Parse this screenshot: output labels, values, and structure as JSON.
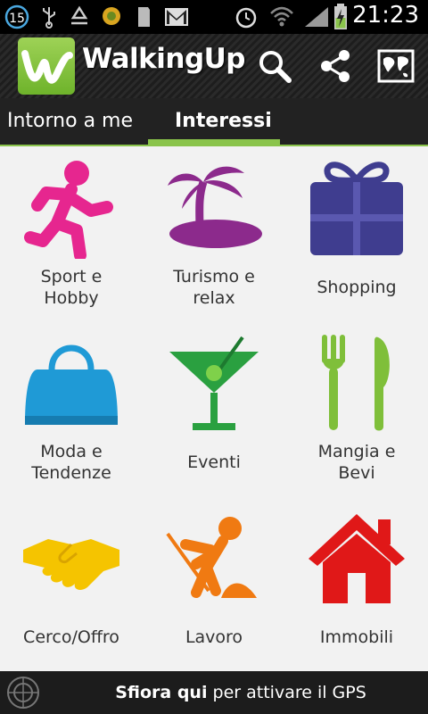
{
  "status_bar": {
    "notification_count": "15",
    "time": "21:23",
    "icons": [
      "notification-count-icon",
      "usb-icon",
      "recycle-icon",
      "flower-icon",
      "sd-card-icon",
      "gmail-icon",
      "alarm-icon",
      "wifi-icon",
      "signal-icon",
      "battery-charging-icon"
    ]
  },
  "action_bar": {
    "app_title": "WalkingUp",
    "logo_letter": "W",
    "actions": [
      "search-icon",
      "share-icon",
      "map-icon"
    ]
  },
  "tabs": [
    {
      "label": "Intorno a me",
      "selected": false
    },
    {
      "label": "Interessi",
      "selected": true
    }
  ],
  "categories": [
    {
      "label_line1": "Sport e",
      "label_line2": "Hobby",
      "icon": "runner-icon",
      "color": "#e6268f"
    },
    {
      "label_line1": "Turismo e",
      "label_line2": "relax",
      "icon": "palm-island-icon",
      "color": "#8c2a8c"
    },
    {
      "label_line1": "Shopping",
      "label_line2": "",
      "icon": "gift-box-icon",
      "color": "#3f3d8f"
    },
    {
      "label_line1": "Moda e",
      "label_line2": "Tendenze",
      "icon": "handbag-icon",
      "color": "#1f9ad6"
    },
    {
      "label_line1": "Eventi",
      "label_line2": "",
      "icon": "cocktail-icon",
      "color": "#2aa040"
    },
    {
      "label_line1": "Mangia e",
      "label_line2": "Bevi",
      "icon": "fork-knife-icon",
      "color": "#7fbf3a"
    },
    {
      "label_line1": "Cerco/Offro",
      "label_line2": "",
      "icon": "handshake-icon",
      "color": "#f5c400"
    },
    {
      "label_line1": "Lavoro",
      "label_line2": "",
      "icon": "worker-digging-icon",
      "color": "#f07a12"
    },
    {
      "label_line1": "Immobili",
      "label_line2": "",
      "icon": "house-icon",
      "color": "#e01818"
    }
  ],
  "bottom_bar": {
    "bold": "Sfiora qui",
    "rest": " per attivare il GPS"
  },
  "colors": {
    "accent": "#8ac44b",
    "tab_bg": "#222222",
    "grid_bg": "#f2f2f2"
  }
}
